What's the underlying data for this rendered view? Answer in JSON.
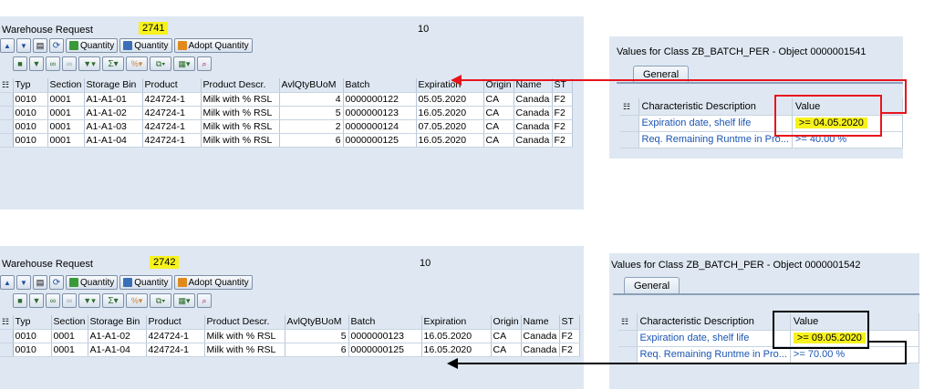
{
  "columns": [
    "Typ",
    "Section",
    "Storage Bin",
    "Product",
    "Product Descr.",
    "AvlQtyBUoM",
    "Batch",
    "Expiration",
    "Origin",
    "Name",
    "ST"
  ],
  "toolbar": {
    "quantity1": "Quantity",
    "quantity2": "Quantity",
    "adopt": "Adopt Quantity"
  },
  "top": {
    "wr_label": "Warehouse Request",
    "wr_number": "2741",
    "count": "10",
    "rows": [
      [
        "0010",
        "0001",
        "A1-A1-01",
        "424724-1",
        "Milk with % RSL",
        "4",
        "0000000122",
        "05.05.2020",
        "CA",
        "Canada",
        "F2"
      ],
      [
        "0010",
        "0001",
        "A1-A1-02",
        "424724-1",
        "Milk with % RSL",
        "5",
        "0000000123",
        "16.05.2020",
        "CA",
        "Canada",
        "F2"
      ],
      [
        "0010",
        "0001",
        "A1-A1-03",
        "424724-1",
        "Milk with % RSL",
        "2",
        "0000000124",
        "07.05.2020",
        "CA",
        "Canada",
        "F2"
      ],
      [
        "0010",
        "0001",
        "A1-A1-04",
        "424724-1",
        "Milk with % RSL",
        "6",
        "0000000125",
        "16.05.2020",
        "CA",
        "Canada",
        "F2"
      ]
    ],
    "class_title": "Values for Class ZB_BATCH_PER - Object 0000001541",
    "tab": "General",
    "char_header": [
      "Characteristic Description",
      "Value"
    ],
    "chars": [
      {
        "desc": "Expiration date, shelf life",
        "value": ">= 04.05.2020"
      },
      {
        "desc": "Req. Remaining Runtme in Pro...",
        "value": ">= 40.00 %"
      }
    ]
  },
  "bottom": {
    "wr_label": "Warehouse Request",
    "wr_number": "2742",
    "count": "10",
    "rows": [
      [
        "0010",
        "0001",
        "A1-A1-02",
        "424724-1",
        "Milk with % RSL",
        "5",
        "0000000123",
        "16.05.2020",
        "CA",
        "Canada",
        "F2"
      ],
      [
        "0010",
        "0001",
        "A1-A1-04",
        "424724-1",
        "Milk with % RSL",
        "6",
        "0000000125",
        "16.05.2020",
        "CA",
        "Canada",
        "F2"
      ]
    ],
    "class_title": "Values for Class ZB_BATCH_PER - Object 0000001542",
    "tab": "General",
    "char_header": [
      "Characteristic Description",
      "Value"
    ],
    "chars": [
      {
        "desc": "Expiration date, shelf life",
        "value": ">= 09.05.2020"
      },
      {
        "desc": "Req. Remaining Runtme in Pro...",
        "value": ">= 70.00 %"
      }
    ]
  },
  "colors": {
    "highlight": "#f7f21c",
    "red_box": "#e8141c",
    "black_box": "#000000",
    "link": "#1a55b3"
  }
}
